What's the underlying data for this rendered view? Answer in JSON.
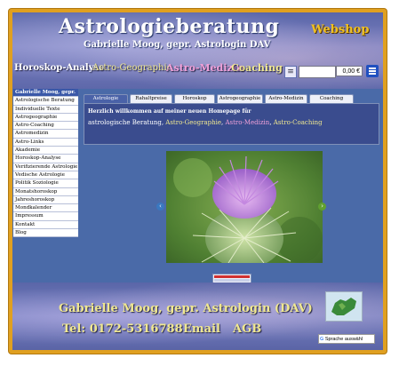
{
  "header": {
    "title": "Astrologieberatung",
    "subtitle": "Gabrielle Moog, gepr. Astrologin DAV",
    "webshop": "Webshop"
  },
  "topnav": [
    {
      "label": "Horoskop-Analyse",
      "color": "#ffffff"
    },
    {
      "label": "Astro-Geographie",
      "color": "#f0e890"
    },
    {
      "label": "Astro-Medizin",
      "color": "#f0a0d8"
    },
    {
      "label": "Coaching",
      "color": "#f0e890"
    }
  ],
  "cart": {
    "icon": "list-icon",
    "total": "0,00 €"
  },
  "sidebar": {
    "items": [
      "Gabrielle Moog, gepr.",
      "Astrologische Beratung",
      "Individuelle Texte",
      "Astrogeographie",
      "Astro-Coaching",
      "Astromedizin",
      "Astro-Links",
      "Akademie",
      "Horoskop-Analyse",
      "Verifizierende Astrologie",
      "Vedische Astrologie",
      "Politik Soziologie",
      "Monatshoroskop",
      "Jahreshoroskop",
      "Mondkalender",
      "Impressum",
      "Kontakt",
      "Blog"
    ]
  },
  "tabs": [
    "Astrologie",
    "Rahaltpreise",
    "Horoskop",
    "Astrogeographie",
    "Astro-Medizin",
    "Coaching"
  ],
  "welcome": {
    "heading": "Herzlich willkommen auf meiner neuen Homepage für",
    "links": [
      {
        "label": "astrologische Beratung",
        "color": "#ffffff"
      },
      {
        "label": "Astro-Geographie",
        "color": "#f0e890"
      },
      {
        "label": "Astro-Medizin",
        "color": "#f0a0d8"
      },
      {
        "label": "Astro-Coaching",
        "color": "#f0e890"
      }
    ],
    "separator": ", "
  },
  "footer": {
    "name": "Gabrielle Moog, gepr. Astrologin (DAV)",
    "phone": "Tel: 0172-5316788",
    "email": "Email",
    "agb": "AGB",
    "translate_label": "Sprache auswähl"
  },
  "colors": {
    "accent": "#e0a020",
    "background": "#4a6aa8",
    "panel": "#3a4c8e"
  }
}
